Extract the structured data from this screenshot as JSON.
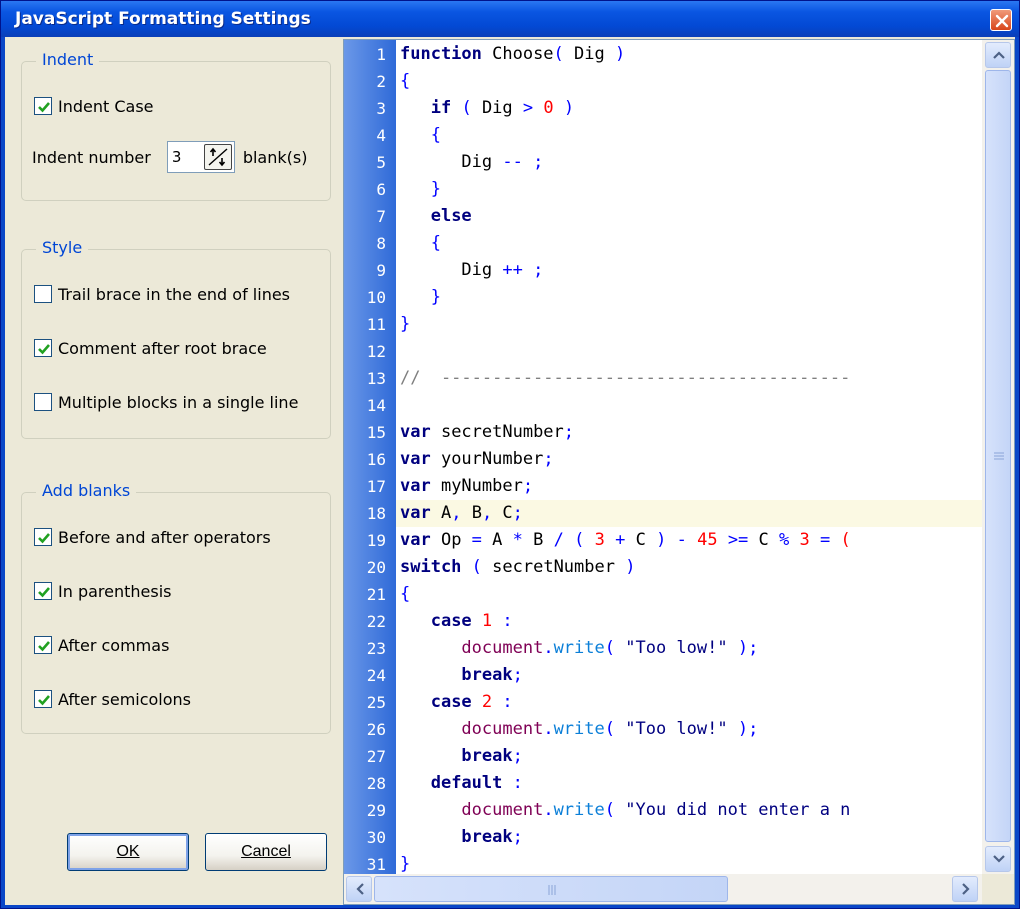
{
  "window": {
    "title": "JavaScript Formatting Settings"
  },
  "indent": {
    "legend": "Indent",
    "indent_case_label": "Indent Case",
    "indent_case_checked": true,
    "indent_number_label": "Indent number",
    "indent_number_value": "3",
    "blank_label": "blank(s)"
  },
  "style": {
    "legend": "Style",
    "items": [
      {
        "label": "Trail brace in the end of lines",
        "checked": false
      },
      {
        "label": "Comment after root brace",
        "checked": true
      },
      {
        "label": "Multiple blocks in a single line",
        "checked": false
      }
    ]
  },
  "add_blanks": {
    "legend": "Add blanks",
    "items": [
      {
        "label": "Before and after operators",
        "checked": true
      },
      {
        "label": "In parenthesis",
        "checked": true
      },
      {
        "label": "After commas",
        "checked": true
      },
      {
        "label": "After semicolons",
        "checked": true
      }
    ]
  },
  "buttons": {
    "ok": "OK",
    "cancel": "Cancel"
  },
  "editor": {
    "highlighted_line": 18,
    "lines": [
      [
        [
          "kw",
          "function"
        ],
        [
          "id",
          " Choose"
        ],
        [
          "op",
          "("
        ],
        [
          "id",
          " Dig "
        ],
        [
          "op",
          ")"
        ]
      ],
      [
        [
          "op",
          "{"
        ]
      ],
      [
        [
          "id",
          "   "
        ],
        [
          "kw",
          "if"
        ],
        [
          "id",
          " "
        ],
        [
          "op",
          "("
        ],
        [
          "id",
          " Dig "
        ],
        [
          "op",
          ">"
        ],
        [
          "id",
          " "
        ],
        [
          "num",
          "0"
        ],
        [
          "id",
          " "
        ],
        [
          "op",
          ")"
        ]
      ],
      [
        [
          "id",
          "   "
        ],
        [
          "op",
          "{"
        ]
      ],
      [
        [
          "id",
          "      Dig "
        ],
        [
          "op",
          "--"
        ],
        [
          "id",
          " "
        ],
        [
          "op",
          ";"
        ]
      ],
      [
        [
          "id",
          "   "
        ],
        [
          "op",
          "}"
        ]
      ],
      [
        [
          "id",
          "   "
        ],
        [
          "kw",
          "else"
        ]
      ],
      [
        [
          "id",
          "   "
        ],
        [
          "op",
          "{"
        ]
      ],
      [
        [
          "id",
          "      Dig "
        ],
        [
          "op",
          "++"
        ],
        [
          "id",
          " "
        ],
        [
          "op",
          ";"
        ]
      ],
      [
        [
          "id",
          "   "
        ],
        [
          "op",
          "}"
        ]
      ],
      [
        [
          "op",
          "}"
        ]
      ],
      [
        [
          "id",
          ""
        ]
      ],
      [
        [
          "cmt",
          "//  ----------------------------------------"
        ]
      ],
      [
        [
          "id",
          ""
        ]
      ],
      [
        [
          "kw",
          "var"
        ],
        [
          "id",
          " secretNumber"
        ],
        [
          "op",
          ";"
        ]
      ],
      [
        [
          "kw",
          "var"
        ],
        [
          "id",
          " yourNumber"
        ],
        [
          "op",
          ";"
        ]
      ],
      [
        [
          "kw",
          "var"
        ],
        [
          "id",
          " myNumber"
        ],
        [
          "op",
          ";"
        ]
      ],
      [
        [
          "kw",
          "var"
        ],
        [
          "id",
          " A"
        ],
        [
          "op",
          ","
        ],
        [
          "id",
          " B"
        ],
        [
          "op",
          ","
        ],
        [
          "id",
          " C"
        ],
        [
          "op",
          ";"
        ]
      ],
      [
        [
          "kw",
          "var"
        ],
        [
          "id",
          " Op "
        ],
        [
          "op",
          "="
        ],
        [
          "id",
          " A "
        ],
        [
          "op",
          "*"
        ],
        [
          "id",
          " B "
        ],
        [
          "op",
          "/"
        ],
        [
          "id",
          " "
        ],
        [
          "op",
          "("
        ],
        [
          "id",
          " "
        ],
        [
          "num",
          "3"
        ],
        [
          "id",
          " "
        ],
        [
          "op",
          "+"
        ],
        [
          "id",
          " C "
        ],
        [
          "op",
          ")"
        ],
        [
          "id",
          " "
        ],
        [
          "op",
          "-"
        ],
        [
          "id",
          " "
        ],
        [
          "num",
          "45"
        ],
        [
          "id",
          " "
        ],
        [
          "op",
          ">="
        ],
        [
          "id",
          " C "
        ],
        [
          "op",
          "%"
        ],
        [
          "id",
          " "
        ],
        [
          "num",
          "3"
        ],
        [
          "id",
          " "
        ],
        [
          "op",
          "="
        ],
        [
          "id",
          " "
        ],
        [
          "num",
          "("
        ]
      ],
      [
        [
          "kw",
          "switch"
        ],
        [
          "id",
          " "
        ],
        [
          "op",
          "("
        ],
        [
          "id",
          " secretNumber "
        ],
        [
          "op",
          ")"
        ]
      ],
      [
        [
          "op",
          "{"
        ]
      ],
      [
        [
          "id",
          "   "
        ],
        [
          "kw",
          "case"
        ],
        [
          "id",
          " "
        ],
        [
          "num",
          "1"
        ],
        [
          "id",
          " "
        ],
        [
          "op",
          ":"
        ]
      ],
      [
        [
          "id",
          "      "
        ],
        [
          "obj",
          "document"
        ],
        [
          "op",
          "."
        ],
        [
          "meth",
          "write"
        ],
        [
          "op",
          "("
        ],
        [
          "id",
          " "
        ],
        [
          "str",
          "\"Too low!\""
        ],
        [
          "id",
          " "
        ],
        [
          "op",
          ");"
        ]
      ],
      [
        [
          "id",
          "      "
        ],
        [
          "kw",
          "break"
        ],
        [
          "op",
          ";"
        ]
      ],
      [
        [
          "id",
          "   "
        ],
        [
          "kw",
          "case"
        ],
        [
          "id",
          " "
        ],
        [
          "num",
          "2"
        ],
        [
          "id",
          " "
        ],
        [
          "op",
          ":"
        ]
      ],
      [
        [
          "id",
          "      "
        ],
        [
          "obj",
          "document"
        ],
        [
          "op",
          "."
        ],
        [
          "meth",
          "write"
        ],
        [
          "op",
          "("
        ],
        [
          "id",
          " "
        ],
        [
          "str",
          "\"Too low!\""
        ],
        [
          "id",
          " "
        ],
        [
          "op",
          ");"
        ]
      ],
      [
        [
          "id",
          "      "
        ],
        [
          "kw",
          "break"
        ],
        [
          "op",
          ";"
        ]
      ],
      [
        [
          "id",
          "   "
        ],
        [
          "kw",
          "default"
        ],
        [
          "id",
          " "
        ],
        [
          "op",
          ":"
        ]
      ],
      [
        [
          "id",
          "      "
        ],
        [
          "obj",
          "document"
        ],
        [
          "op",
          "."
        ],
        [
          "meth",
          "write"
        ],
        [
          "op",
          "("
        ],
        [
          "id",
          " "
        ],
        [
          "str",
          "\"You did not enter a n"
        ]
      ],
      [
        [
          "id",
          "      "
        ],
        [
          "kw",
          "break"
        ],
        [
          "op",
          ";"
        ]
      ],
      [
        [
          "op",
          "}"
        ]
      ]
    ]
  }
}
